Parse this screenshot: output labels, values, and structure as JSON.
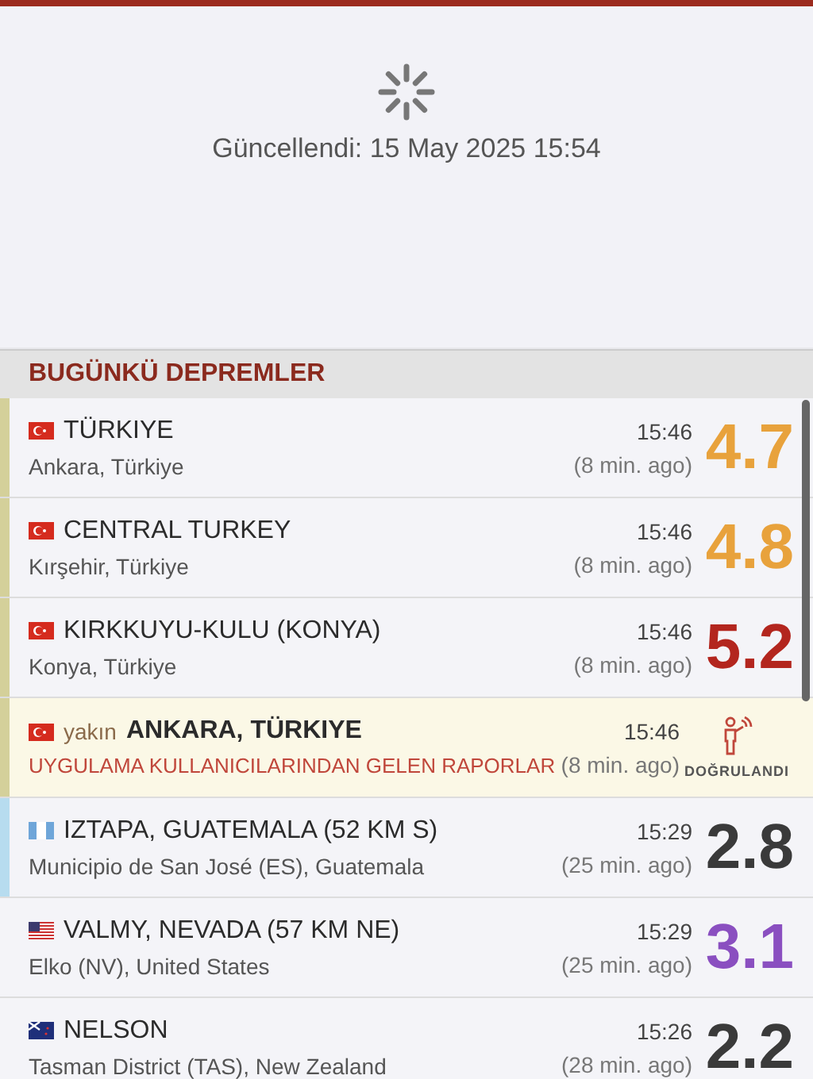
{
  "refresh": {
    "updated": "Güncellendi: 15 May 2025 15:54"
  },
  "section": {
    "title": "BUGÜNKÜ DEPREMLER"
  },
  "quakes": [
    {
      "kind": "quake",
      "flag": {
        "kind": "tr"
      },
      "title": "TÜRKIYE",
      "subtitle": "Ankara, Türkiye",
      "time": "15:46",
      "ago": "(8 min. ago)",
      "magnitude": "4.7",
      "color": "#e8a23c",
      "stripe": {
        "color": "#d4d09a"
      }
    },
    {
      "kind": "quake",
      "flag": {
        "kind": "tr"
      },
      "title": "CENTRAL TURKEY",
      "subtitle": "Kırşehir, Türkiye",
      "time": "15:46",
      "ago": "(8 min. ago)",
      "magnitude": "4.8",
      "color": "#e8a23c",
      "stripe": {
        "color": "#d4d09a"
      }
    },
    {
      "kind": "quake",
      "flag": {
        "kind": "tr"
      },
      "title": "KIRKKUYU-KULU (KONYA)",
      "subtitle": "Konya, Türkiye",
      "time": "15:46",
      "ago": "(8 min. ago)",
      "magnitude": "5.2",
      "color": "#b3261e",
      "stripe": {
        "color": "#d4d09a"
      }
    },
    {
      "kind": "report",
      "flag": {
        "kind": "tr"
      },
      "prefix": "yakın",
      "title": "ANKARA, TÜRKIYE",
      "subtitle": "UYGULAMA KULLANICILARINDAN GELEN RAPORLAR",
      "time": "15:46",
      "ago": "(8 min. ago)",
      "badge": "DOĞRULANDI",
      "stripe": {
        "color": "#d4d09a"
      }
    },
    {
      "kind": "quake",
      "flag": {
        "kind": "gt"
      },
      "title": "IZTAPA, GUATEMALA (52 KM S)",
      "subtitle": "Municipio de San José (ES), Guatemala",
      "time": "15:29",
      "ago": "(25 min. ago)",
      "magnitude": "2.8",
      "color": "#3a3a3a",
      "stripe": {
        "color": "#b7dcef"
      }
    },
    {
      "kind": "quake",
      "flag": {
        "kind": "us"
      },
      "title": "VALMY, NEVADA (57 KM NE)",
      "subtitle": "Elko (NV), United States",
      "time": "15:29",
      "ago": "(25 min. ago)",
      "magnitude": "3.1",
      "color": "#8a4fc0"
    },
    {
      "kind": "quake",
      "flag": {
        "kind": "nz"
      },
      "title": "NELSON",
      "subtitle": "Tasman District (TAS), New Zealand",
      "time": "15:26",
      "ago": "(28 min. ago)",
      "magnitude": "2.2",
      "color": "#3a3a3a"
    }
  ]
}
